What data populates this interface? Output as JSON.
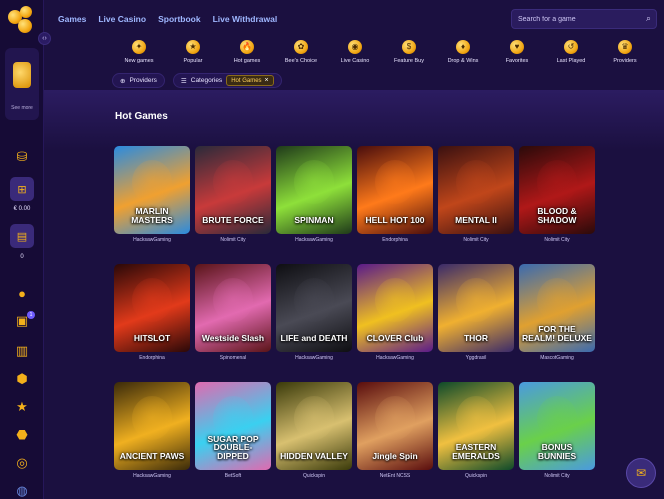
{
  "sidebar": {
    "see_more": "See more",
    "balance": "€ 0.00",
    "count": "0",
    "badge": "1"
  },
  "nav": {
    "items": [
      "Games",
      "Live Casino",
      "Sportbook",
      "Live Withdrawal"
    ]
  },
  "search": {
    "placeholder": "Search for a game"
  },
  "categories": [
    {
      "label": "New games",
      "icon": "new-games-icon",
      "glyph": "✦"
    },
    {
      "label": "Popular",
      "icon": "popular-icon",
      "glyph": "★"
    },
    {
      "label": "Hot games",
      "icon": "hot-games-icon",
      "glyph": "🔥"
    },
    {
      "label": "Bee's Choice",
      "icon": "bees-choice-icon",
      "glyph": "✿"
    },
    {
      "label": "Live Casino",
      "icon": "live-casino-icon",
      "glyph": "◉"
    },
    {
      "label": "Feature Buy",
      "icon": "feature-buy-icon",
      "glyph": "$"
    },
    {
      "label": "Drop & Wins",
      "icon": "drops-wins-icon",
      "glyph": "♦"
    },
    {
      "label": "Favorites",
      "icon": "favorites-icon",
      "glyph": "♥"
    },
    {
      "label": "Last Played",
      "icon": "last-played-icon",
      "glyph": "↺"
    },
    {
      "label": "Providers",
      "icon": "providers-icon",
      "glyph": "♛"
    }
  ],
  "filters": {
    "providers": "Providers",
    "categories": "Categories",
    "active_tag": "Hot Games"
  },
  "section": {
    "title": "Hot Games"
  },
  "games": [
    {
      "title": "MARLIN MASTERS",
      "provider": "HacksawGaming",
      "c1": "#2a8be0",
      "c2": "#f0a030"
    },
    {
      "title": "BRUTE FORCE",
      "provider": "Nolimit City",
      "c1": "#2a2a3a",
      "c2": "#c83a3a"
    },
    {
      "title": "SPINMAN",
      "provider": "HacksawGaming",
      "c1": "#1f3a1a",
      "c2": "#8ee03a"
    },
    {
      "title": "HELL HOT 100",
      "provider": "Endorphina",
      "c1": "#4a0d0d",
      "c2": "#ff7a1a"
    },
    {
      "title": "MENTAL II",
      "provider": "Nolimit City",
      "c1": "#3a1010",
      "c2": "#c0461a"
    },
    {
      "title": "BLOOD & SHADOW",
      "provider": "Nolimit City",
      "c1": "#2a0a0a",
      "c2": "#b01818"
    },
    {
      "title": "HITSLOT",
      "provider": "Endorphina",
      "c1": "#2a0808",
      "c2": "#e23a1a"
    },
    {
      "title": "Westside Slash",
      "provider": "Spinomenal",
      "c1": "#5a1418",
      "c2": "#e26ab0"
    },
    {
      "title": "LIFE and DEATH",
      "provider": "HacksawGaming",
      "c1": "#0e0e12",
      "c2": "#4a4a55"
    },
    {
      "title": "CLOVER Club",
      "provider": "HacksawGaming",
      "c1": "#5a1a8a",
      "c2": "#f0c020"
    },
    {
      "title": "THOR",
      "provider": "Yggdrasil",
      "c1": "#3a2a6a",
      "c2": "#f0b030"
    },
    {
      "title": "FOR THE REALM! DELUXE",
      "provider": "MascotGaming",
      "c1": "#3a6ab0",
      "c2": "#e0a030"
    },
    {
      "title": "ANCIENT PAWS",
      "provider": "HacksawGaming",
      "c1": "#3a2a0a",
      "c2": "#f0b020"
    },
    {
      "title": "SUGAR POP DOUBLE-DIPPED",
      "provider": "BetSoft",
      "c1": "#e06ab0",
      "c2": "#3ad0f0"
    },
    {
      "title": "HIDDEN VALLEY",
      "provider": "Quickspin",
      "c1": "#3a3a0a",
      "c2": "#d8c070"
    },
    {
      "title": "Jingle Spin",
      "provider": "NetEnt NCSS",
      "c1": "#5a0d0d",
      "c2": "#e0a060"
    },
    {
      "title": "EASTERN EMERALDS",
      "provider": "Quickspin",
      "c1": "#0d4a2a",
      "c2": "#f0c040"
    },
    {
      "title": "BONUS BUNNIES",
      "provider": "Nolimit City",
      "c1": "#4a9ae0",
      "c2": "#6ad04a"
    }
  ],
  "colors": {
    "bg": "#1b1040",
    "accent": "#f3b01b",
    "nav_link": "#9fb7ff"
  }
}
